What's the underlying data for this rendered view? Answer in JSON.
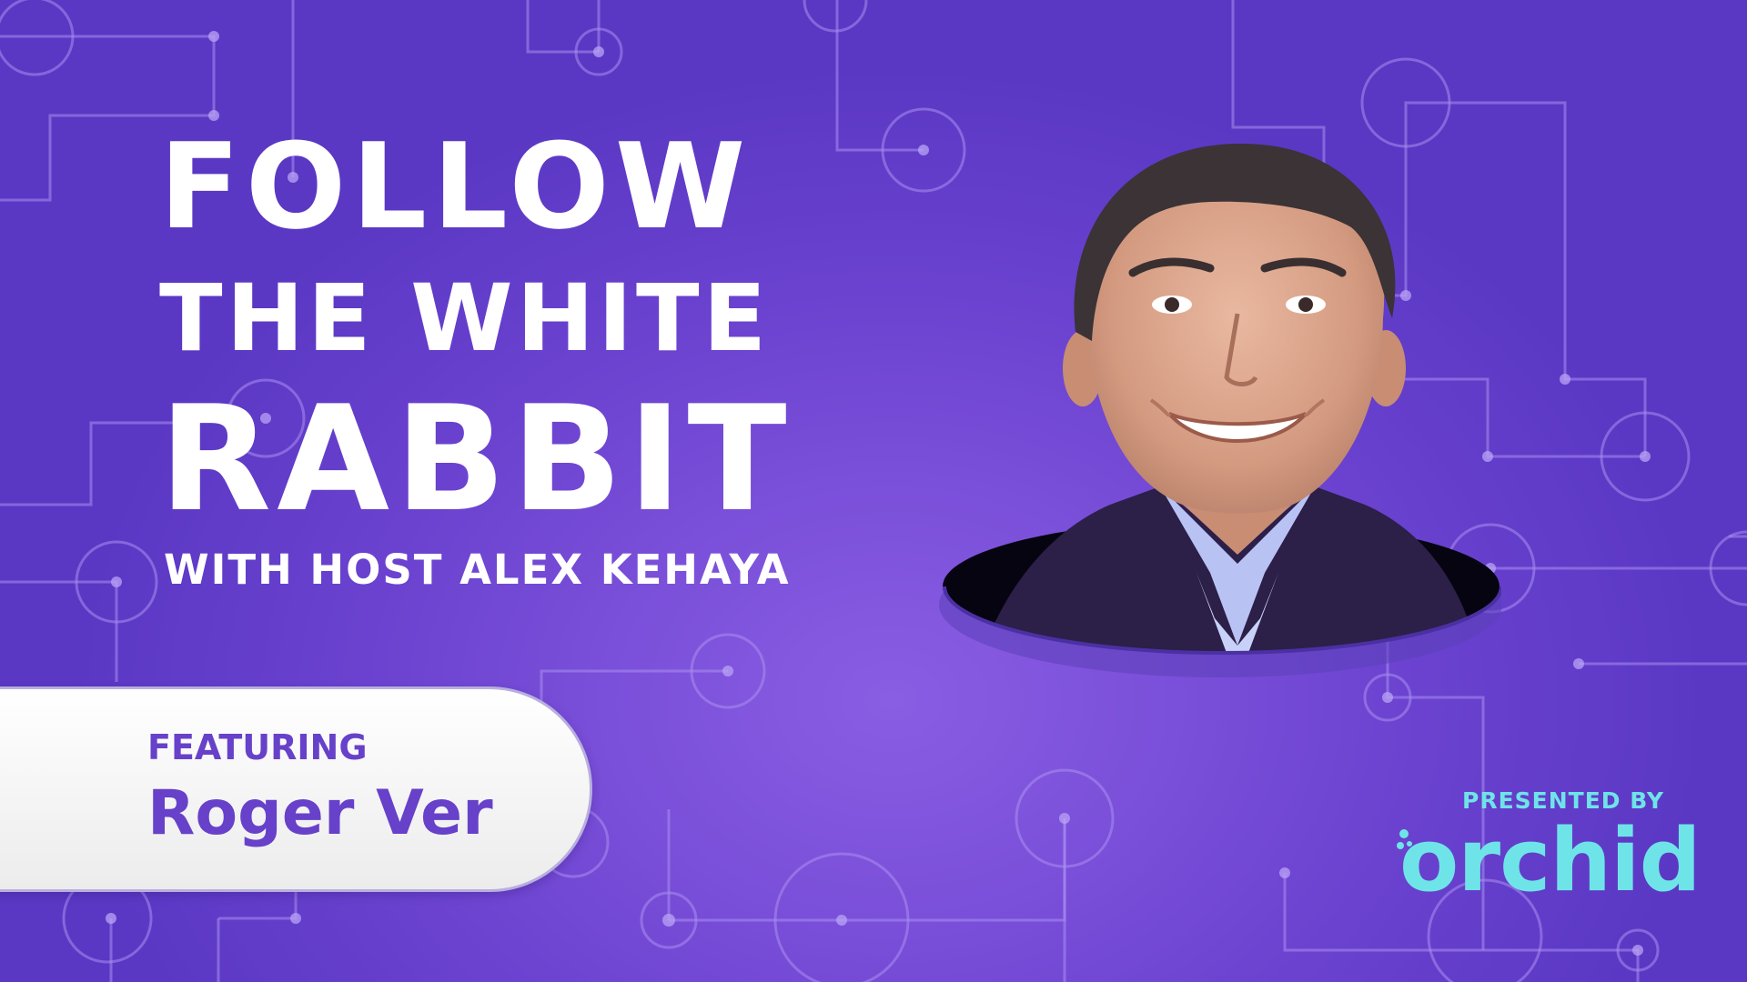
{
  "title": {
    "line1": "FOLLOW",
    "line2": "THE WHITE",
    "line3": "RABBIT"
  },
  "host_line": "WITH HOST ALEX KEHAYA",
  "featuring": {
    "label": "FEATURING",
    "name": "Roger Ver"
  },
  "sponsor": {
    "presented_by": "PRESENTED BY",
    "brand": "orchid"
  },
  "colors": {
    "background": "#6a42cf",
    "title_text": "#ffffff",
    "featuring_text": "#6741c9",
    "sponsor_accent": "#6fe4e8"
  },
  "icons": [
    "circuit-pattern",
    "portrait-photo",
    "orchid-logo"
  ]
}
